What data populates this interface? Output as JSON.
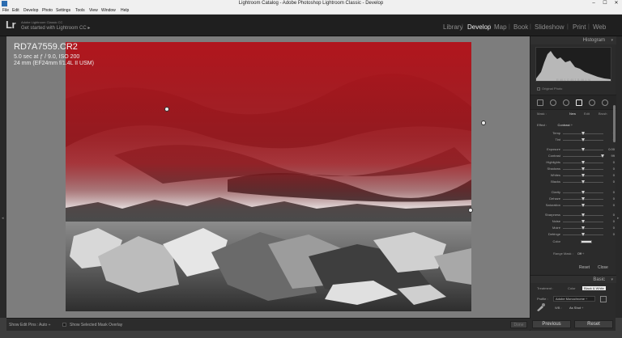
{
  "window": {
    "title": "Lightroom Catalog - Adobe Photoshop Lightroom Classic - Develop",
    "controls": [
      "–",
      "☐",
      "✕"
    ]
  },
  "menu": [
    "File",
    "Edit",
    "Develop",
    "Photo",
    "Settings",
    "Tools",
    "View",
    "Window",
    "Help"
  ],
  "identity": {
    "logo": "Lr",
    "subtitle": "Adobe Lightroom Classic CC",
    "message": "Get started with Lightroom CC ▸"
  },
  "modules": [
    {
      "label": "Library",
      "active": false
    },
    {
      "label": "Develop",
      "active": true
    },
    {
      "label": "Map",
      "active": false
    },
    {
      "label": "Book",
      "active": false
    },
    {
      "label": "Slideshow",
      "active": false
    },
    {
      "label": "Print",
      "active": false
    },
    {
      "label": "Web",
      "active": false
    }
  ],
  "photo_info": {
    "filename": "RD7A7559.CR2",
    "exposure": "5.0 sec at ƒ / 9.0, ISO 200",
    "lens": "24 mm (EF24mm f/1.4L II USM)"
  },
  "toolbar": {
    "edit_pins_label": "Show Edit Pins :",
    "edit_pins_value": "Auto ÷",
    "mask_overlay_label": "Show Selected Mask Overlay",
    "done_label": "Done"
  },
  "histogram": {
    "title": "Histogram",
    "readout": "R 46.1  G 46.1  B 46.1 %",
    "original_photo_label": "Original Photo"
  },
  "mask": {
    "label": "Mask :",
    "new": "New",
    "edit": "Edit",
    "brush": "Brush"
  },
  "effect": {
    "label": "Effect :",
    "value": "Contrast ÷"
  },
  "sliders": [
    {
      "label": "Temp",
      "value": "0",
      "pos": 0.5
    },
    {
      "label": "Tint",
      "value": "0",
      "pos": 0.5
    },
    {
      "label": "Exposure",
      "value": "0.00",
      "pos": 0.5
    },
    {
      "label": "Contrast",
      "value": "99",
      "pos": 0.97
    },
    {
      "label": "Highlights",
      "value": "0",
      "pos": 0.5
    },
    {
      "label": "Shadows",
      "value": "0",
      "pos": 0.5
    },
    {
      "label": "Whites",
      "value": "0",
      "pos": 0.5
    },
    {
      "label": "Blacks",
      "value": "0",
      "pos": 0.5
    },
    {
      "label": "Clarity",
      "value": "0",
      "pos": 0.5
    },
    {
      "label": "Dehaze",
      "value": "0",
      "pos": 0.5
    },
    {
      "label": "Saturation",
      "value": "0",
      "pos": 0.5
    },
    {
      "label": "Sharpness",
      "value": "0",
      "pos": 0.5
    },
    {
      "label": "Noise",
      "value": "0",
      "pos": 0.5
    },
    {
      "label": "Moiré",
      "value": "0",
      "pos": 0.5
    },
    {
      "label": "Defringe",
      "value": "0",
      "pos": 0.5
    }
  ],
  "color_label": "Color",
  "range_mask": {
    "label": "Range Mask :",
    "value": "Off ÷"
  },
  "reset_label": "Reset",
  "close_label": "Close",
  "basic": {
    "title": "Basic",
    "treatment_label": "Treatment :",
    "treatment_color": "Color",
    "treatment_bw": "Black & White",
    "profile_label": "Profile :",
    "profile_value": "Adobe Monochrome ÷",
    "wb_label": "WB :",
    "wb_value": "As Shot ÷"
  },
  "bottom_buttons": {
    "previous": "Previous",
    "reset": "Reset"
  },
  "colors": {
    "mask_overlay": "#c0141c",
    "panel_bg": "#2b2b2b",
    "canvas_bg": "#7d7d7d"
  }
}
